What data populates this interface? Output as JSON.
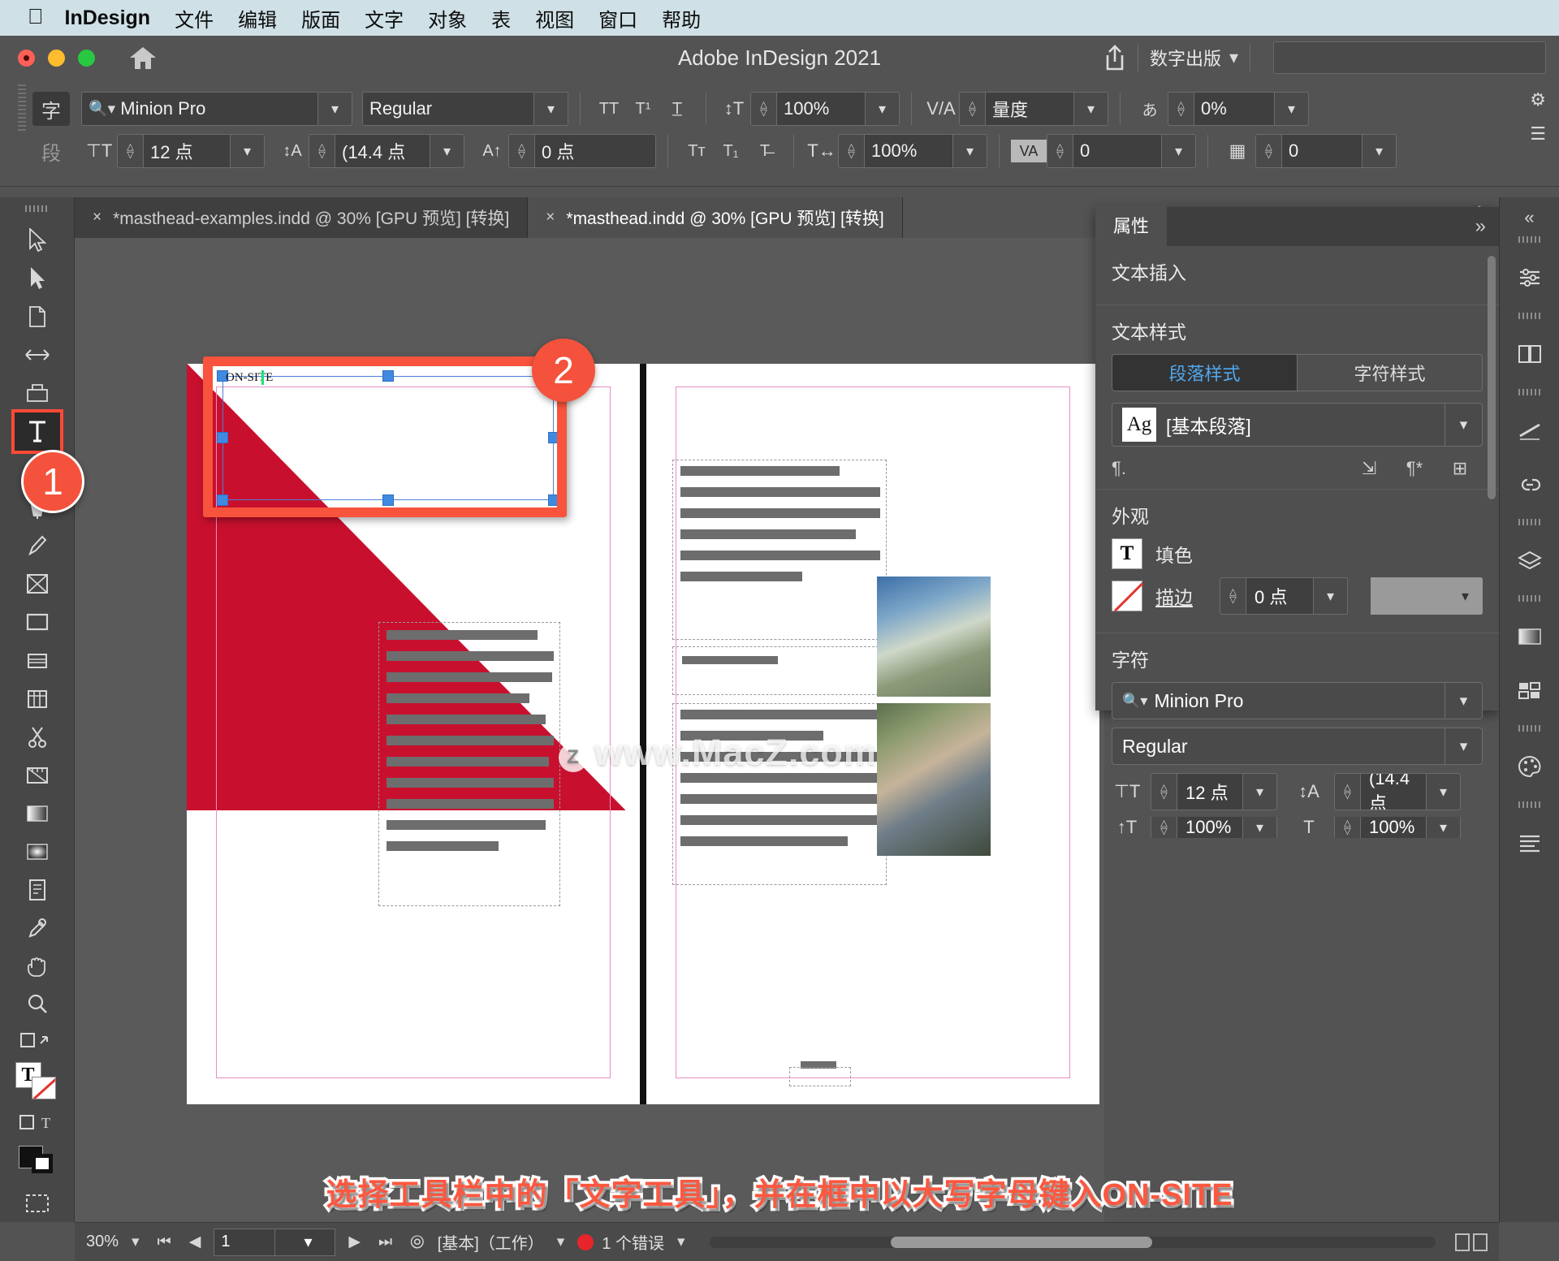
{
  "menubar": {
    "apple": "apple-logo",
    "app": "InDesign",
    "items": [
      "文件",
      "编辑",
      "版面",
      "文字",
      "对象",
      "表",
      "视图",
      "窗口",
      "帮助"
    ]
  },
  "titlebar": {
    "title": "Adobe InDesign 2021",
    "home_icon": "home-icon",
    "share_icon": "share-icon",
    "workspace": "数字出版",
    "workspace_chevron": "chevron-down-icon",
    "search_placeholder": ""
  },
  "controlbar": {
    "mode_char": "字",
    "mode_para": "段",
    "font_family": "Minion Pro",
    "font_style": "Regular",
    "font_size": "12 点",
    "leading": "(14.4 点",
    "baseline_shift": "0 点",
    "vertical_scale": "100%",
    "horizontal_scale": "100%",
    "kerning": "量度",
    "tracking": "0",
    "tsume": "0%",
    "grid_value": "0",
    "case_icons": [
      "TT",
      "T¹",
      "T̲"
    ],
    "case_icons2": [
      "Tᴛ",
      "T₁",
      "T̶"
    ],
    "lightning_icon": "lightning-icon",
    "gear_icon": "gear-icon",
    "menu_icon": "hamburger-icon"
  },
  "tabs": [
    {
      "label": "*masthead-examples.indd @ 30% [GPU 预览] [转换]",
      "active": false,
      "close": "×"
    },
    {
      "label": "*masthead.indd @ 30% [GPU 预览] [转换]",
      "active": true,
      "close": "×"
    }
  ],
  "tools": [
    {
      "name": "selection-tool",
      "selected": false
    },
    {
      "name": "direct-selection-tool",
      "selected": false
    },
    {
      "name": "page-tool",
      "selected": false
    },
    {
      "name": "gap-tool",
      "selected": false
    },
    {
      "name": "content-collector-tool",
      "selected": false
    },
    {
      "name": "type-tool",
      "selected": true
    },
    {
      "name": "line-tool",
      "selected": false
    },
    {
      "name": "pen-tool",
      "selected": false
    },
    {
      "name": "pencil-tool",
      "selected": false
    },
    {
      "name": "frame-tool",
      "selected": false
    },
    {
      "name": "rectangle-tool",
      "selected": false
    },
    {
      "name": "free-transform-tool",
      "selected": false
    },
    {
      "name": "table-tool",
      "selected": false
    },
    {
      "name": "scissors-tool",
      "selected": false
    },
    {
      "name": "measure-tool",
      "selected": false
    },
    {
      "name": "gradient-swatch-tool",
      "selected": false
    },
    {
      "name": "gradient-feather-tool",
      "selected": false
    },
    {
      "name": "note-tool",
      "selected": false
    },
    {
      "name": "eyedropper-tool",
      "selected": false
    },
    {
      "name": "hand-tool",
      "selected": false
    },
    {
      "name": "zoom-tool",
      "selected": false
    }
  ],
  "canvas": {
    "text_frame_content": "ON-SITE",
    "badge_1": "1",
    "badge_2": "2",
    "watermark": "www.MacZ.com",
    "watermark_badge": "Z"
  },
  "properties": {
    "tab": "属性",
    "collapse_icon": "chevron-double-right-icon",
    "section_insert": "文本插入",
    "section_textstyle": "文本样式",
    "seg_paragraph": "段落样式",
    "seg_character": "字符样式",
    "style_name": "[基本段落]",
    "style_thumb": "Ag",
    "section_appearance": "外观",
    "fill_label": "填色",
    "stroke_label": "描边",
    "stroke_weight": "0 点",
    "section_character": "字符",
    "char_font": "Minion Pro",
    "char_style": "Regular",
    "char_size": "12 点",
    "char_leading": "(14.4 点",
    "char_vscale": "100%",
    "char_hscale": "100%"
  },
  "rightdock": {
    "icons": [
      "properties-icon",
      "pages-icon",
      "stroke-icon",
      "links-icon",
      "layers-icon",
      "gradient-icon",
      "cc-libraries-icon",
      "color-icon",
      "paragraph-icon"
    ]
  },
  "caption": "选择工具栏中的「文字工具」，并在框中以大写字母键入ON-SITE",
  "statusbar": {
    "zoom": "30%",
    "zoom_chevron": "chevron-down-icon",
    "first_page_icon": "first-page-icon",
    "prev_page_icon": "prev-page-icon",
    "page_number": "1",
    "page_chevron": "chevron-down-icon",
    "next_page_icon": "next-page-icon",
    "last_page_icon": "last-page-icon",
    "preflight_icon": "preflight-icon",
    "preflight_profile": "[基本]（工作）",
    "profile_chevron": "chevron-down-icon",
    "error_text": "1 个错误",
    "error_chevron": "chevron-down-icon",
    "error_color": "#e8252a"
  },
  "colors": {
    "accent_red": "#c8102e",
    "callout_orange": "#f8533c",
    "selection_blue": "#3f8ae0",
    "panel_bg": "#4f4f4f",
    "app_bg": "#535353",
    "menubar_bg": "#cfe0e6"
  }
}
